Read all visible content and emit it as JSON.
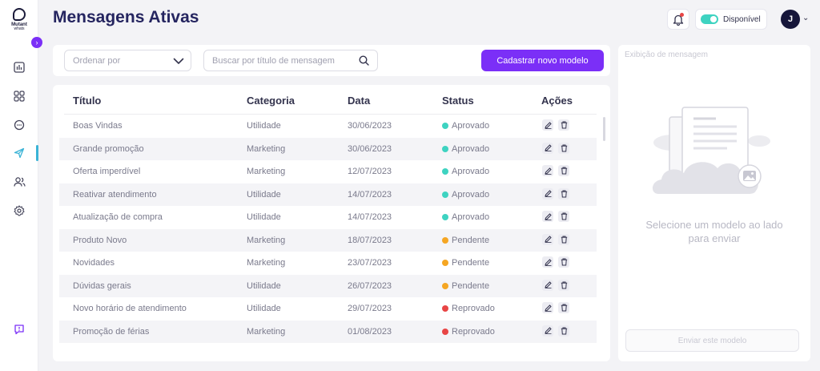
{
  "app": {
    "logo_text": "Mutant",
    "logo_sub": "whats"
  },
  "sidebar": {
    "items": [
      {
        "icon": "chart-icon",
        "key": "dashboard"
      },
      {
        "icon": "grid-icon",
        "key": "apps"
      },
      {
        "icon": "chat-icon",
        "key": "conversations"
      },
      {
        "icon": "send-icon",
        "key": "active-messages",
        "active": true
      },
      {
        "icon": "users-icon",
        "key": "contacts"
      },
      {
        "icon": "gear-icon",
        "key": "settings"
      }
    ],
    "help_icon": "help-chat-icon"
  },
  "header": {
    "title": "Mensagens Ativas",
    "status_label": "Disponível",
    "status_on": true,
    "avatar_initial": "J"
  },
  "filters": {
    "order_placeholder": "Ordenar por",
    "search_placeholder": "Buscar por título de mensagem",
    "new_button": "Cadastrar novo modelo"
  },
  "table": {
    "headers": {
      "title": "Título",
      "category": "Categoria",
      "date": "Data",
      "status": "Status",
      "actions": "Ações"
    },
    "rows": [
      {
        "title": "Boas Vindas",
        "category": "Utilidade",
        "date": "30/06/2023",
        "status": "Aprovado",
        "status_color": "#3ed3c1"
      },
      {
        "title": "Grande promoção",
        "category": "Marketing",
        "date": "30/06/2023",
        "status": "Aprovado",
        "status_color": "#3ed3c1"
      },
      {
        "title": "Oferta imperdível",
        "category": "Marketing",
        "date": "12/07/2023",
        "status": "Aprovado",
        "status_color": "#3ed3c1"
      },
      {
        "title": "Reativar atendimento",
        "category": "Utilidade",
        "date": "14/07/2023",
        "status": "Aprovado",
        "status_color": "#3ed3c1"
      },
      {
        "title": "Atualização de compra",
        "category": "Utilidade",
        "date": "14/07/2023",
        "status": "Aprovado",
        "status_color": "#3ed3c1"
      },
      {
        "title": "Produto Novo",
        "category": "Marketing",
        "date": "18/07/2023",
        "status": "Pendente",
        "status_color": "#f5a623"
      },
      {
        "title": "Novidades",
        "category": "Marketing",
        "date": "23/07/2023",
        "status": "Pendente",
        "status_color": "#f5a623"
      },
      {
        "title": "Dúvidas gerais",
        "category": "Utilidade",
        "date": "26/07/2023",
        "status": "Pendente",
        "status_color": "#f5a623"
      },
      {
        "title": "Novo horário de atendimento",
        "category": "Utilidade",
        "date": "29/07/2023",
        "status": "Reprovado",
        "status_color": "#e84545"
      },
      {
        "title": "Promoção de férias",
        "category": "Marketing",
        "date": "01/08/2023",
        "status": "Reprovado",
        "status_color": "#e84545"
      }
    ]
  },
  "preview": {
    "title": "Exibição de mensagem",
    "empty_message": "Selecione um modelo ao lado para enviar",
    "send_button": "Enviar este modelo"
  },
  "colors": {
    "accent": "#7b2ff7",
    "title": "#252560",
    "approved": "#3ed3c1",
    "pending": "#f5a623",
    "rejected": "#e84545"
  }
}
